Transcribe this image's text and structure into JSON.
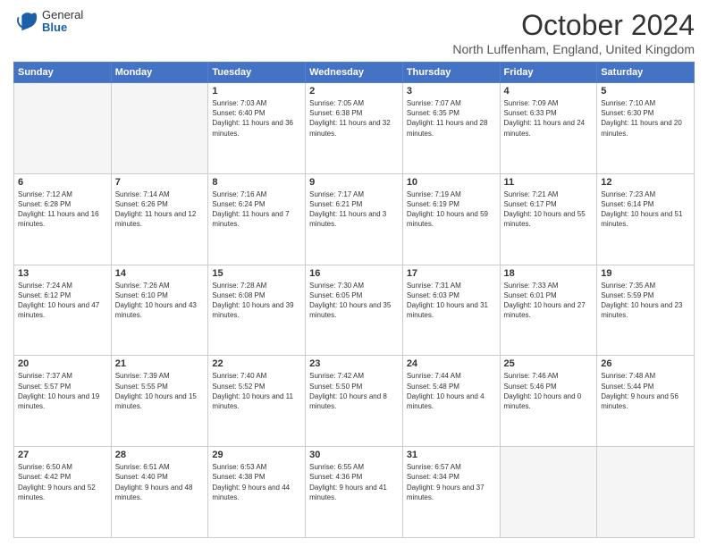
{
  "header": {
    "logo_general": "General",
    "logo_blue": "Blue",
    "month_title": "October 2024",
    "location": "North Luffenham, England, United Kingdom"
  },
  "days_of_week": [
    "Sunday",
    "Monday",
    "Tuesday",
    "Wednesday",
    "Thursday",
    "Friday",
    "Saturday"
  ],
  "weeks": [
    [
      {
        "day": "",
        "empty": true
      },
      {
        "day": "",
        "empty": true
      },
      {
        "day": "1",
        "sunrise": "7:03 AM",
        "sunset": "6:40 PM",
        "daylight": "11 hours and 36 minutes."
      },
      {
        "day": "2",
        "sunrise": "7:05 AM",
        "sunset": "6:38 PM",
        "daylight": "11 hours and 32 minutes."
      },
      {
        "day": "3",
        "sunrise": "7:07 AM",
        "sunset": "6:35 PM",
        "daylight": "11 hours and 28 minutes."
      },
      {
        "day": "4",
        "sunrise": "7:09 AM",
        "sunset": "6:33 PM",
        "daylight": "11 hours and 24 minutes."
      },
      {
        "day": "5",
        "sunrise": "7:10 AM",
        "sunset": "6:30 PM",
        "daylight": "11 hours and 20 minutes."
      }
    ],
    [
      {
        "day": "6",
        "sunrise": "7:12 AM",
        "sunset": "6:28 PM",
        "daylight": "11 hours and 16 minutes."
      },
      {
        "day": "7",
        "sunrise": "7:14 AM",
        "sunset": "6:26 PM",
        "daylight": "11 hours and 12 minutes."
      },
      {
        "day": "8",
        "sunrise": "7:16 AM",
        "sunset": "6:24 PM",
        "daylight": "11 hours and 7 minutes."
      },
      {
        "day": "9",
        "sunrise": "7:17 AM",
        "sunset": "6:21 PM",
        "daylight": "11 hours and 3 minutes."
      },
      {
        "day": "10",
        "sunrise": "7:19 AM",
        "sunset": "6:19 PM",
        "daylight": "10 hours and 59 minutes."
      },
      {
        "day": "11",
        "sunrise": "7:21 AM",
        "sunset": "6:17 PM",
        "daylight": "10 hours and 55 minutes."
      },
      {
        "day": "12",
        "sunrise": "7:23 AM",
        "sunset": "6:14 PM",
        "daylight": "10 hours and 51 minutes."
      }
    ],
    [
      {
        "day": "13",
        "sunrise": "7:24 AM",
        "sunset": "6:12 PM",
        "daylight": "10 hours and 47 minutes."
      },
      {
        "day": "14",
        "sunrise": "7:26 AM",
        "sunset": "6:10 PM",
        "daylight": "10 hours and 43 minutes."
      },
      {
        "day": "15",
        "sunrise": "7:28 AM",
        "sunset": "6:08 PM",
        "daylight": "10 hours and 39 minutes."
      },
      {
        "day": "16",
        "sunrise": "7:30 AM",
        "sunset": "6:05 PM",
        "daylight": "10 hours and 35 minutes."
      },
      {
        "day": "17",
        "sunrise": "7:31 AM",
        "sunset": "6:03 PM",
        "daylight": "10 hours and 31 minutes."
      },
      {
        "day": "18",
        "sunrise": "7:33 AM",
        "sunset": "6:01 PM",
        "daylight": "10 hours and 27 minutes."
      },
      {
        "day": "19",
        "sunrise": "7:35 AM",
        "sunset": "5:59 PM",
        "daylight": "10 hours and 23 minutes."
      }
    ],
    [
      {
        "day": "20",
        "sunrise": "7:37 AM",
        "sunset": "5:57 PM",
        "daylight": "10 hours and 19 minutes."
      },
      {
        "day": "21",
        "sunrise": "7:39 AM",
        "sunset": "5:55 PM",
        "daylight": "10 hours and 15 minutes."
      },
      {
        "day": "22",
        "sunrise": "7:40 AM",
        "sunset": "5:52 PM",
        "daylight": "10 hours and 11 minutes."
      },
      {
        "day": "23",
        "sunrise": "7:42 AM",
        "sunset": "5:50 PM",
        "daylight": "10 hours and 8 minutes."
      },
      {
        "day": "24",
        "sunrise": "7:44 AM",
        "sunset": "5:48 PM",
        "daylight": "10 hours and 4 minutes."
      },
      {
        "day": "25",
        "sunrise": "7:46 AM",
        "sunset": "5:46 PM",
        "daylight": "10 hours and 0 minutes."
      },
      {
        "day": "26",
        "sunrise": "7:48 AM",
        "sunset": "5:44 PM",
        "daylight": "9 hours and 56 minutes."
      }
    ],
    [
      {
        "day": "27",
        "sunrise": "6:50 AM",
        "sunset": "4:42 PM",
        "daylight": "9 hours and 52 minutes."
      },
      {
        "day": "28",
        "sunrise": "6:51 AM",
        "sunset": "4:40 PM",
        "daylight": "9 hours and 48 minutes."
      },
      {
        "day": "29",
        "sunrise": "6:53 AM",
        "sunset": "4:38 PM",
        "daylight": "9 hours and 44 minutes."
      },
      {
        "day": "30",
        "sunrise": "6:55 AM",
        "sunset": "4:36 PM",
        "daylight": "9 hours and 41 minutes."
      },
      {
        "day": "31",
        "sunrise": "6:57 AM",
        "sunset": "4:34 PM",
        "daylight": "9 hours and 37 minutes."
      },
      {
        "day": "",
        "empty": true
      },
      {
        "day": "",
        "empty": true
      }
    ]
  ],
  "labels": {
    "sunrise": "Sunrise:",
    "sunset": "Sunset:",
    "daylight": "Daylight:"
  }
}
